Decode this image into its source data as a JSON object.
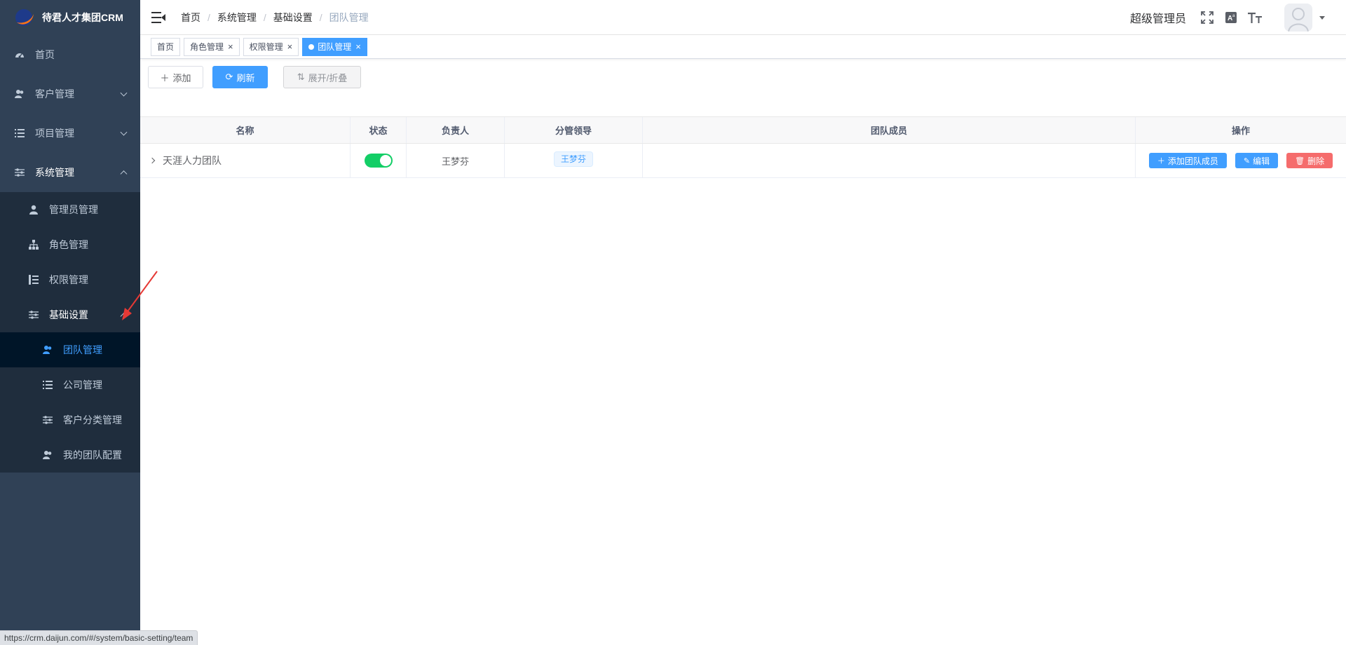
{
  "app": {
    "title": "待君人才集团CRM"
  },
  "sidebar": {
    "items": [
      {
        "label": "首页"
      },
      {
        "label": "客户管理"
      },
      {
        "label": "项目管理"
      },
      {
        "label": "系统管理"
      }
    ],
    "system_children": [
      {
        "label": "管理员管理"
      },
      {
        "label": "角色管理"
      },
      {
        "label": "权限管理"
      },
      {
        "label": "基础设置"
      }
    ],
    "basic_children": [
      {
        "label": "团队管理"
      },
      {
        "label": "公司管理"
      },
      {
        "label": "客户分类管理"
      },
      {
        "label": "我的团队配置"
      }
    ]
  },
  "breadcrumb": [
    "首页",
    "系统管理",
    "基础设置",
    "团队管理"
  ],
  "header": {
    "user_name": "超级管理员"
  },
  "tags": [
    {
      "label": "首页"
    },
    {
      "label": "角色管理"
    },
    {
      "label": "权限管理"
    },
    {
      "label": "团队管理"
    }
  ],
  "toolbar": {
    "add_label": "添加",
    "refresh_label": "刷新",
    "toggle_label": "展开/折叠"
  },
  "table": {
    "columns": [
      "名称",
      "状态",
      "负责人",
      "分管领导",
      "团队成员",
      "操作"
    ],
    "rows": [
      {
        "name": "天涯人力团队",
        "status_on": true,
        "owner": "王梦芬",
        "leader": "王梦芬",
        "members": ""
      }
    ],
    "actions": {
      "add_member": "添加团队成员",
      "edit": "编辑",
      "delete": "删除"
    }
  },
  "status_url": "https://crm.daijun.com/#/system/basic-setting/team",
  "colors": {
    "sidebar_bg": "#304156",
    "primary": "#409eff",
    "danger": "#f56c6c",
    "success": "#13ce66"
  }
}
